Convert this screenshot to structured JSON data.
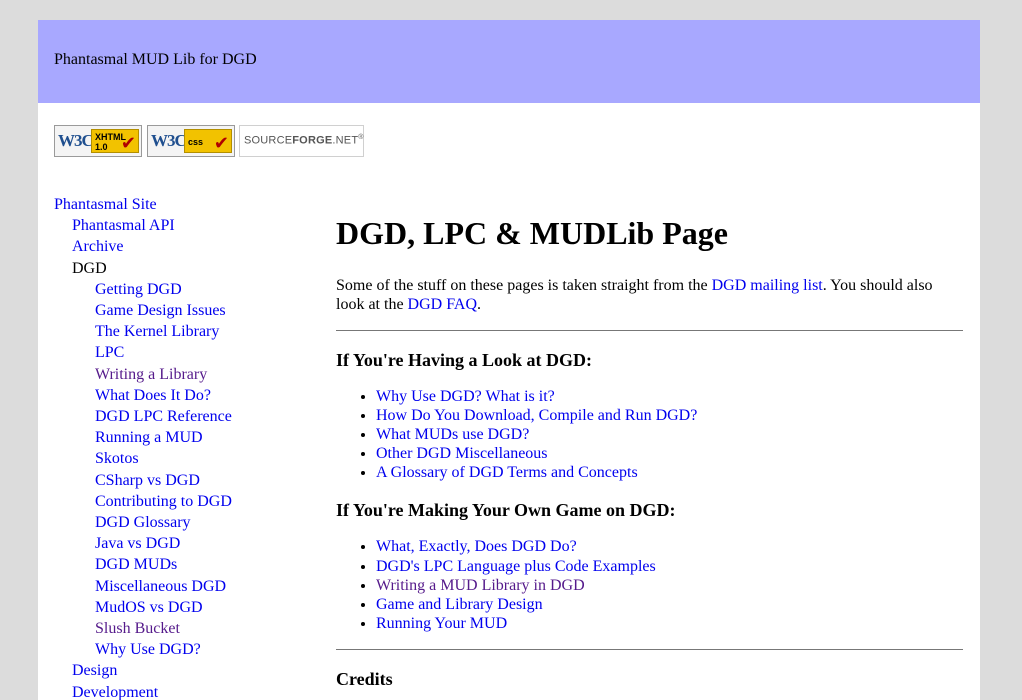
{
  "header": {
    "title": "Phantasmal MUD Lib for DGD"
  },
  "badges": {
    "xhtml": {
      "logo": "W3C",
      "line1": "XHTML",
      "line2": "1.0"
    },
    "css": {
      "logo": "W3C",
      "line1": "css"
    },
    "sourceforge": {
      "part1": "SOURCE",
      "part2": "FORGE",
      "part3": ".NET",
      "mark": "®"
    }
  },
  "sidebar": {
    "items": [
      {
        "label": "Phantasmal Site",
        "level": 0,
        "state": "link"
      },
      {
        "label": "Phantasmal API",
        "level": 1,
        "state": "link"
      },
      {
        "label": "Archive",
        "level": 1,
        "state": "link"
      },
      {
        "label": "DGD",
        "level": 1,
        "state": "current"
      },
      {
        "label": "Getting DGD",
        "level": 2,
        "state": "link"
      },
      {
        "label": "Game Design Issues",
        "level": 2,
        "state": "link"
      },
      {
        "label": "The Kernel Library",
        "level": 2,
        "state": "link"
      },
      {
        "label": "LPC",
        "level": 2,
        "state": "link"
      },
      {
        "label": "Writing a Library",
        "level": 2,
        "state": "visited"
      },
      {
        "label": "What Does It Do?",
        "level": 2,
        "state": "link"
      },
      {
        "label": "DGD LPC Reference",
        "level": 2,
        "state": "link"
      },
      {
        "label": "Running a MUD",
        "level": 2,
        "state": "link"
      },
      {
        "label": "Skotos",
        "level": 2,
        "state": "link"
      },
      {
        "label": "CSharp vs DGD",
        "level": 2,
        "state": "link"
      },
      {
        "label": "Contributing to DGD",
        "level": 2,
        "state": "link"
      },
      {
        "label": "DGD Glossary",
        "level": 2,
        "state": "link"
      },
      {
        "label": "Java vs DGD",
        "level": 2,
        "state": "link"
      },
      {
        "label": "DGD MUDs",
        "level": 2,
        "state": "link"
      },
      {
        "label": "Miscellaneous DGD",
        "level": 2,
        "state": "link"
      },
      {
        "label": "MudOS vs DGD",
        "level": 2,
        "state": "link"
      },
      {
        "label": "Slush Bucket",
        "level": 2,
        "state": "visited"
      },
      {
        "label": "Why Use DGD?",
        "level": 2,
        "state": "link"
      },
      {
        "label": "Design",
        "level": 1,
        "state": "link"
      },
      {
        "label": "Development",
        "level": 1,
        "state": "link"
      }
    ]
  },
  "main": {
    "title": "DGD, LPC & MUDLib Page",
    "intro": {
      "text1": "Some of the stuff on these pages is taken straight from the ",
      "link1": "DGD mailing list",
      "text2": ". You should also look at the ",
      "link2": "DGD FAQ",
      "text3": "."
    },
    "section1": {
      "heading": "If You're Having a Look at DGD:",
      "links": [
        {
          "label": "Why Use DGD? What is it?",
          "state": "link"
        },
        {
          "label": "How Do You Download, Compile and Run DGD?",
          "state": "link"
        },
        {
          "label": "What MUDs use DGD?",
          "state": "link"
        },
        {
          "label": "Other DGD Miscellaneous",
          "state": "link"
        },
        {
          "label": "A Glossary of DGD Terms and Concepts",
          "state": "link"
        }
      ]
    },
    "section2": {
      "heading": "If You're Making Your Own Game on DGD:",
      "links": [
        {
          "label": "What, Exactly, Does DGD Do?",
          "state": "link"
        },
        {
          "label": "DGD's LPC Language plus Code Examples",
          "state": "link"
        },
        {
          "label": "Writing a MUD Library in DGD",
          "state": "visited"
        },
        {
          "label": "Game and Library Design",
          "state": "link"
        },
        {
          "label": "Running Your MUD",
          "state": "link"
        }
      ]
    },
    "credits_heading": "Credits"
  },
  "colors": {
    "header_bg": "#a8a8ff",
    "link": "#0000ee",
    "visited": "#551a8b",
    "outer_bg": "#dcdcdc"
  }
}
